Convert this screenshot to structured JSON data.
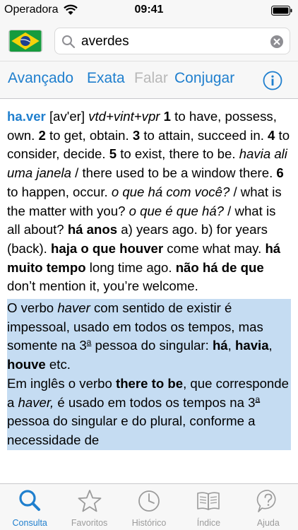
{
  "status_bar": {
    "carrier": "Operadora",
    "time": "09:41"
  },
  "search": {
    "value": "averdes",
    "flag_icon": "brazil-flag-icon"
  },
  "toolbar": {
    "advanced": "Avançado",
    "exact": "Exata",
    "speak": "Falar",
    "conjugate": "Conjugar"
  },
  "entry": {
    "headword": "ha.ver",
    "pronunciation": "[av'er]",
    "pos": "vtd+vint+vpr",
    "n1": "1",
    "s1": " to have, possess, own. ",
    "n2": "2",
    "s2": " to get, obtain. ",
    "n3": "3",
    "s3": " to attain, succeed in. ",
    "n4": "4",
    "s4": " to consider, decide. ",
    "n5": "5",
    "s5": " to exist, there to be. ",
    "ex5": "havia ali uma janela",
    "tr5": " / there used to be a window there. ",
    "n6": "6",
    "s6": " to happen, occur. ",
    "ex6a": "o que há com você?",
    "tr6a": " / what is the matter with you? ",
    "ex6b": "o que é que há?",
    "tr6b": " / what is all about? ",
    "ph1": "há anos",
    "ph1t": " a) years ago. b) for years (back). ",
    "ph2": "haja o que houver",
    "ph2t": " come what may. ",
    "ph3": "há muito tempo",
    "ph3t": " long time ago. ",
    "ph4": "não há de que",
    "ph4t": " don’t mention it, you’re welcome."
  },
  "note": {
    "p1a": "O verbo ",
    "p1b": "haver",
    "p1c": " com sentido de existir é impessoal, usado em todos os tempos, mas somente na 3",
    "p1sup": "a",
    "p1d": " pessoa do singular: ",
    "p1e": "há",
    "p1f": ", ",
    "p1g": "havia",
    "p1h": ", ",
    "p1i": "houve",
    "p1j": " etc.",
    "p2a": "Em inglês o verbo ",
    "p2b": "there to be",
    "p2c": ", que corresponde a ",
    "p2d": "haver,",
    "p2e": " é usado em todos os tempos na 3",
    "p2sup": "a",
    "p2f": " pessoa do singular e do plural, conforme a necessidade de"
  },
  "tabs": [
    {
      "label": "Consulta",
      "icon": "search-icon"
    },
    {
      "label": "Favoritos",
      "icon": "star-icon"
    },
    {
      "label": "Histórico",
      "icon": "clock-icon"
    },
    {
      "label": "Índice",
      "icon": "book-icon"
    },
    {
      "label": "Ajuda",
      "icon": "help-icon"
    }
  ],
  "colors": {
    "accent": "#1f7fce",
    "note_bg": "#c5dcf2",
    "bar_bg": "#f7f7f7",
    "inactive": "#9b9b9b"
  }
}
